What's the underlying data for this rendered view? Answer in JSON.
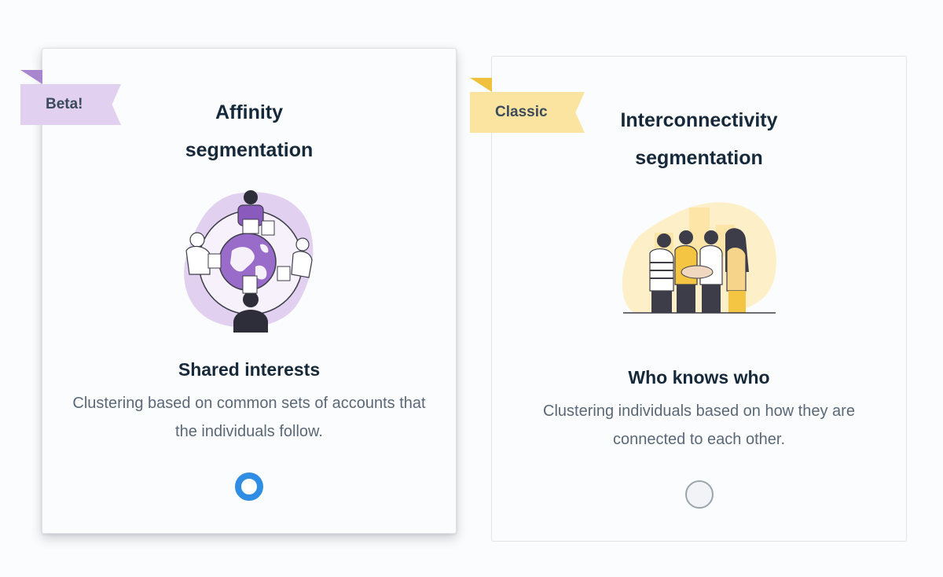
{
  "options": [
    {
      "badge": "Beta!",
      "title_line1": "Affinity",
      "title_line2": "segmentation",
      "illustration": "people-around-globe-illustration",
      "subtitle": "Shared interests",
      "description": "Clustering based on common sets of accounts that the individuals follow.",
      "selected": true,
      "badge_color": "#e2d0f0",
      "accent_color": "#9a6cc9"
    },
    {
      "badge": "Classic",
      "title_line1": "Interconnectivity",
      "title_line2": "segmentation",
      "illustration": "team-hands-together-illustration",
      "subtitle": "Who knows who",
      "description": "Clustering individuals based on how they are connected to each other.",
      "selected": false,
      "badge_color": "#fbe4a0",
      "accent_color": "#f3c542"
    }
  ],
  "colors": {
    "radio_selected": "#2f8de4",
    "text_primary": "#16293a",
    "text_secondary": "#5a6877"
  }
}
